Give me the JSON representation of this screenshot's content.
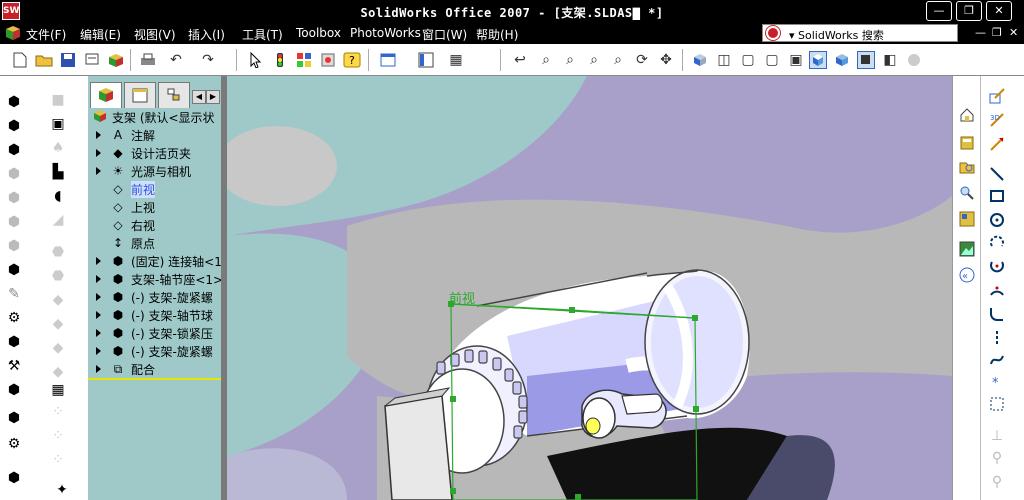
{
  "window": {
    "title": "SolidWorks Office 2007 - [支架.SLDAS▇ *]",
    "logo_text": "SW",
    "minimize": "—",
    "restore": "❐",
    "close": "✕"
  },
  "menu": {
    "items": [
      "文件(F)",
      "编辑(E)",
      "视图(V)",
      "插入(I)",
      "工具(T)",
      "Toolbox",
      "PhotoWorks",
      "窗口(W)",
      "帮助(H)"
    ],
    "search_text": "▾ SolidWorks 搜索",
    "mdi_min": "—",
    "mdi_restore": "❐",
    "mdi_close": "✕"
  },
  "tree": {
    "root_label": "支架  (默认<显示状",
    "nodes": [
      {
        "label": "注解",
        "icon": "A",
        "expandable": true
      },
      {
        "label": "设计活页夹",
        "icon": "◆",
        "expandable": true
      },
      {
        "label": "光源与相机",
        "icon": "☀",
        "expandable": true
      },
      {
        "label": "前视",
        "icon": "◇",
        "expandable": false,
        "selected": true
      },
      {
        "label": "上视",
        "icon": "◇",
        "expandable": false
      },
      {
        "label": "右视",
        "icon": "◇",
        "expandable": false
      },
      {
        "label": "原点",
        "icon": "↕",
        "expandable": false
      },
      {
        "label": "(固定) 连接轴<1",
        "icon": "⬢",
        "expandable": true
      },
      {
        "label": "支架-轴节座<1>",
        "icon": "⬢",
        "expandable": true
      },
      {
        "label": "(-) 支架-旋紧螺",
        "icon": "⬢",
        "expandable": true
      },
      {
        "label": "(-) 支架-轴节球",
        "icon": "⬢",
        "expandable": true
      },
      {
        "label": "(-) 支架-锁紧压",
        "icon": "⬢",
        "expandable": true
      },
      {
        "label": "(-) 支架-旋紧螺",
        "icon": "⬢",
        "expandable": true
      },
      {
        "label": "配合",
        "icon": "⧉",
        "expandable": true
      }
    ]
  },
  "viewport": {
    "plane_label": "前视"
  },
  "colors": {
    "titlebar": "#000000",
    "tree_bg": "#9ec9c8",
    "viewport_bg": "#a8a0c8",
    "plane": "#2da82d"
  }
}
